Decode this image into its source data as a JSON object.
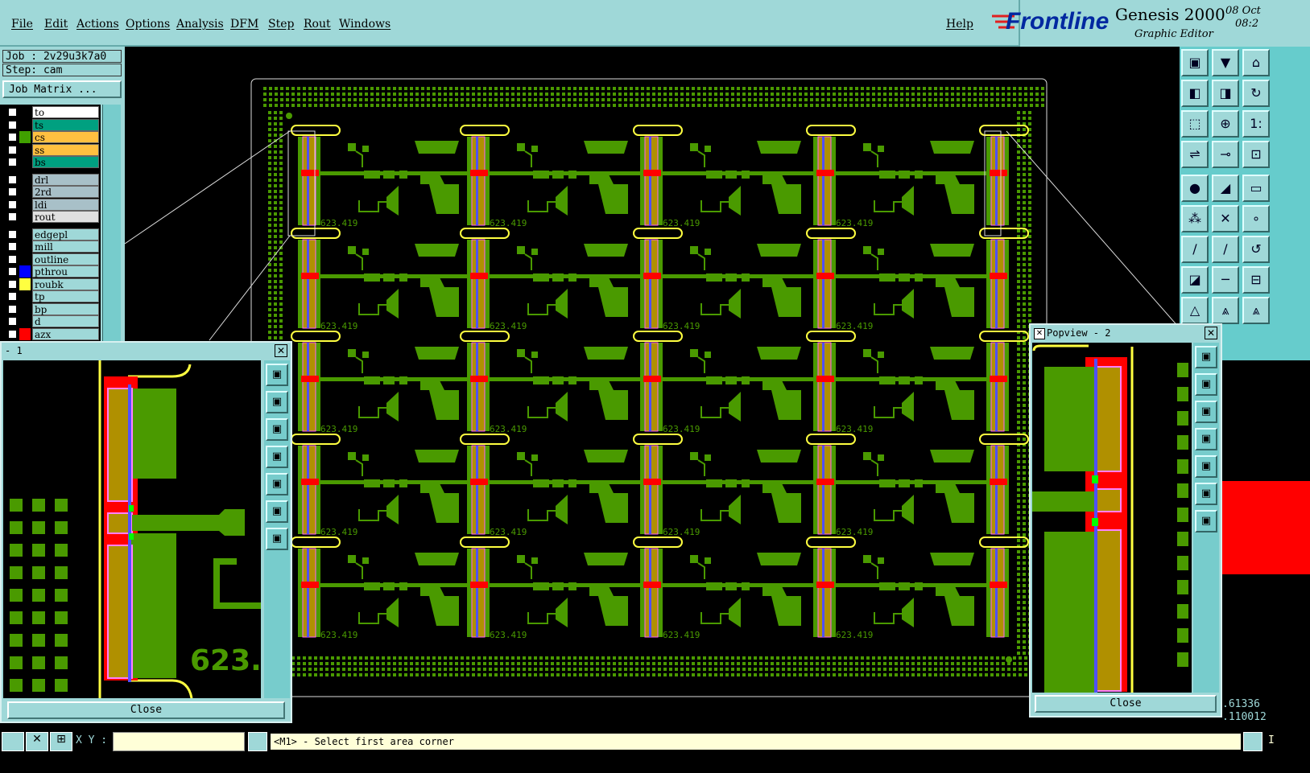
{
  "menu": {
    "items": [
      "File",
      "Edit",
      "Actions",
      "Options",
      "Analysis",
      "DFM",
      "Step",
      "Rout",
      "Windows"
    ],
    "help": "Help"
  },
  "brand": {
    "logo": "Frontline",
    "product": "Genesis 2000",
    "subtitle": "Graphic Editor",
    "date_top": "08 Oct",
    "date_bot": "08:2"
  },
  "job": {
    "job_label": "Job : 2v29u3k7a0",
    "step_label": "Step: cam",
    "matrix_button": "Job Matrix ..."
  },
  "layers": [
    {
      "name": "to",
      "color": "#ffffff",
      "sw": "#000000"
    },
    {
      "name": "ts",
      "color": "#00a080",
      "sw": "#000000"
    },
    {
      "name": "cs",
      "color": "#ffc040",
      "sw": "#40a000"
    },
    {
      "name": "ss",
      "color": "#ffc040",
      "sw": "#000000"
    },
    {
      "name": "bs",
      "color": "#00a080",
      "sw": "#000000"
    },
    {
      "name": "drl",
      "color": "#a8c0c8",
      "sw": "#000000"
    },
    {
      "name": "2rd",
      "color": "#a8c0c8",
      "sw": "#000000"
    },
    {
      "name": "ldi",
      "color": "#a8c0c8",
      "sw": "#000000"
    },
    {
      "name": "rout",
      "color": "#e0e0e0",
      "sw": "#000000"
    },
    {
      "name": "edgepl",
      "color": "#9fd8d8",
      "sw": "#000000"
    },
    {
      "name": "mill",
      "color": "#9fd8d8",
      "sw": "#000000"
    },
    {
      "name": "outline",
      "color": "#9fd8d8",
      "sw": "#000000"
    },
    {
      "name": "pthrou",
      "color": "#9fd8d8",
      "sw": "#0000ff"
    },
    {
      "name": "roubk",
      "color": "#9fd8d8",
      "sw": "#ffff40"
    },
    {
      "name": "tp",
      "color": "#9fd8d8",
      "sw": "#000000"
    },
    {
      "name": "bp",
      "color": "#9fd8d8",
      "sw": "#000000"
    },
    {
      "name": "d",
      "color": "#9fd8d8",
      "sw": "#000000"
    },
    {
      "name": "azx",
      "color": "#9fd8d8",
      "sw": "#ff0000"
    }
  ],
  "popview1": {
    "title": "- 1",
    "close": "Close",
    "text": "623."
  },
  "popview2": {
    "title": "Popview - 2",
    "close": "Close"
  },
  "pcb": {
    "label": "623.419"
  },
  "coords": {
    "a": ".61336",
    "b": ".110012"
  },
  "status": {
    "xy_label": "X Y :",
    "message": "<M1> - Select first area corner",
    "right": "I"
  },
  "colors": {
    "copper": "#4a9a00",
    "gold": "#b09000",
    "red": "#ff0000",
    "yellow": "#ffff40",
    "panel": "#9fd8d8"
  }
}
